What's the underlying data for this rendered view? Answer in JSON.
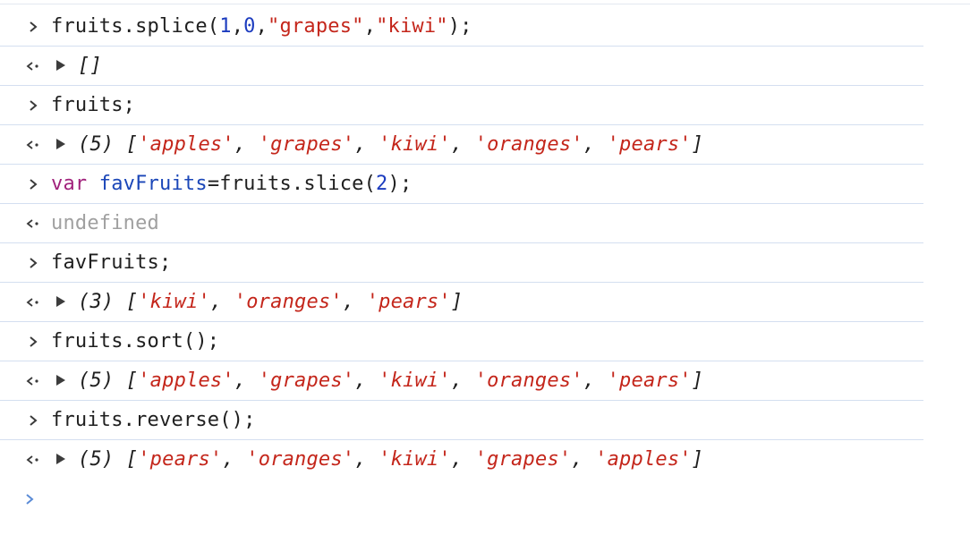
{
  "console": {
    "entries": [
      {
        "type": "input",
        "code": {
          "p1": "fruits.splice(",
          "n1": "1",
          "c1": ",",
          "n2": "0",
          "c2": ",",
          "s1": "\"grapes\"",
          "c3": ",",
          "s2": "\"kiwi\"",
          "p2": ");"
        }
      },
      {
        "type": "output",
        "open": "[",
        "close": "]"
      },
      {
        "type": "input",
        "code": "fruits;"
      },
      {
        "type": "output",
        "count": "(5)",
        "items": [
          "'apples'",
          "'grapes'",
          "'kiwi'",
          "'oranges'",
          "'pears'"
        ]
      },
      {
        "type": "input",
        "code": {
          "kw": "var",
          "ident": "favFruits",
          "p1": "=fruits.slice(",
          "n1": "2",
          "p2": ");"
        }
      },
      {
        "type": "output",
        "text": "undefined"
      },
      {
        "type": "input",
        "code": "favFruits;"
      },
      {
        "type": "output",
        "count": "(3)",
        "items": [
          "'kiwi'",
          "'oranges'",
          "'pears'"
        ]
      },
      {
        "type": "input",
        "code": "fruits.sort();"
      },
      {
        "type": "output",
        "count": "(5)",
        "items": [
          "'apples'",
          "'grapes'",
          "'kiwi'",
          "'oranges'",
          "'pears'"
        ]
      },
      {
        "type": "input",
        "code": "fruits.reverse();"
      },
      {
        "type": "output",
        "count": "(5)",
        "items": [
          "'pears'",
          "'oranges'",
          "'kiwi'",
          "'grapes'",
          "'apples'"
        ]
      }
    ],
    "punct": {
      "open": "[",
      "close": "]",
      "sep": ", "
    }
  },
  "colors": {
    "keyword": "#a1227c",
    "identifier": "#1a46b8",
    "number": "#1c3cbf",
    "string": "#c4261b",
    "undefined": "#a0a0a0",
    "prompt": "#5a8bd6",
    "row_border": "#d4dff0"
  },
  "icons": {
    "input_prompt": "chevron-right-icon",
    "output_marker": "return-arrow-icon",
    "expand": "triangle-right-icon"
  }
}
